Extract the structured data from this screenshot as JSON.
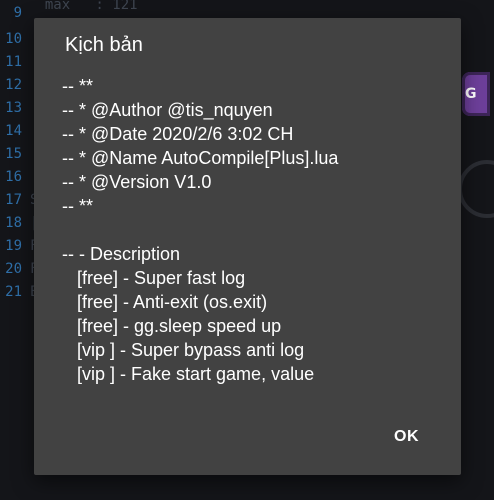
{
  "editor": {
    "top_code": "  max   : 121",
    "line_numbers": [
      "9",
      "10",
      "11",
      "12",
      "13",
      "14",
      "15",
      "16",
      "17",
      "18",
      "19",
      "20",
      "21"
    ],
    "fragments": [
      {
        "line": "17",
        "text": "S"
      },
      {
        "line": "18",
        "text": "|"
      },
      {
        "line": "19",
        "text": "F"
      },
      {
        "line": "20",
        "text": "F"
      },
      {
        "line": "21",
        "text": "E"
      }
    ]
  },
  "overlay_icon": {
    "label": "G",
    "color": "#6d3f9a"
  },
  "dialog": {
    "title": "Kịch bản",
    "lines": [
      "-- **",
      "-- * @Author @tis_nquyen",
      "-- * @Date 2020/2/6 3:02 CH",
      "-- * @Name AutoCompile[Plus].lua",
      "-- * @Version V1.0",
      "-- **",
      "",
      "-- - Description",
      "   [free] - Super fast log",
      "   [free] - Anti-exit (os.exit)",
      "   [free] - gg.sleep speed up",
      "   [vip ] - Super bypass anti log",
      "   [vip ] - Fake start game, value"
    ],
    "ok_label": "OK"
  },
  "colors": {
    "dialog_bg": "#424242",
    "background": "#141519",
    "line_number": "#2f6fa8"
  }
}
